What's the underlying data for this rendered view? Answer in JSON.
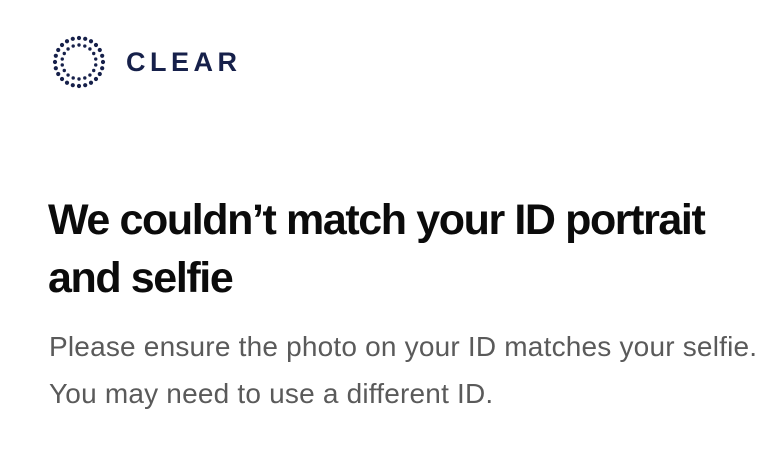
{
  "brand": {
    "name": "CLEAR",
    "logo_icon": "clear-dot-ring-logo",
    "color": "#16204a"
  },
  "message": {
    "title": "We couldn’t match your ID portrait and selfie",
    "body": "Please ensure the photo on your ID matches your selfie. You may need to use a different ID."
  },
  "colors": {
    "background": "#ffffff",
    "title": "#0b0b0b",
    "body": "#5a5a5a"
  }
}
